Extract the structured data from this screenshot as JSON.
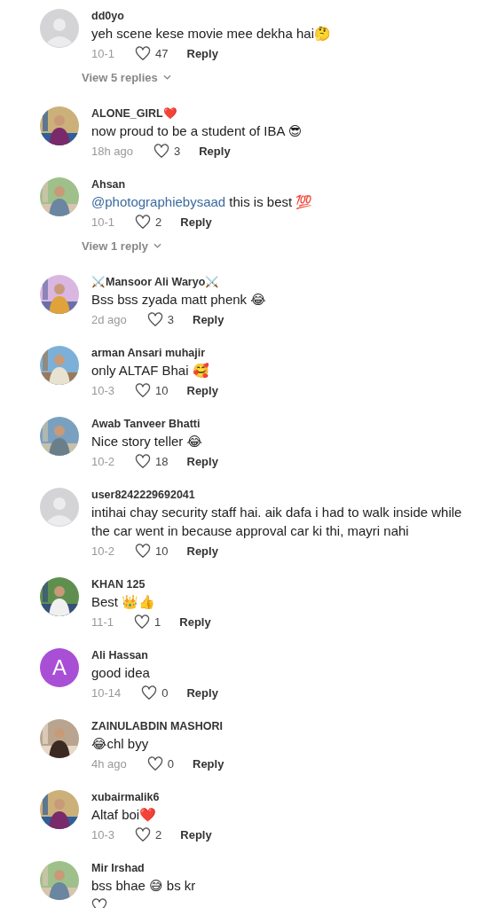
{
  "comments": [
    {
      "avatar": {
        "kind": "default"
      },
      "name": "dd0yo",
      "text": "yeh scene kese movie mee dekha hai🤔",
      "time": "10-1",
      "likes": "47",
      "reply": "Reply",
      "view_replies": "View 5 replies"
    },
    {
      "name": "ALONE_GIRL❤️",
      "text": "now proud to be a student of IBA 😎",
      "time": "18h ago",
      "likes": "3",
      "reply": "Reply"
    },
    {
      "name": "Ahsan",
      "mention": "@photographiebysaad",
      "text": "this is best 💯",
      "time": "10-1",
      "likes": "2",
      "reply": "Reply",
      "view_replies": "View 1 reply"
    },
    {
      "name": "⚔️Mansoor Ali Waryo⚔️",
      "text": "Bss bss zyada matt phenk 😂",
      "time": "2d ago",
      "likes": "3",
      "reply": "Reply"
    },
    {
      "name": "arman Ansari muhajir",
      "text": "only ALTAF Bhai 🥰",
      "time": "10-3",
      "likes": "10",
      "reply": "Reply"
    },
    {
      "name": "Awab Tanveer Bhatti",
      "text": "Nice story teller 😂",
      "time": "10-2",
      "likes": "18",
      "reply": "Reply"
    },
    {
      "avatar": {
        "kind": "default"
      },
      "name": "user8242229692041",
      "text": "intihai chay security staff hai. aik dafa i had to walk inside while the car went in because approval car ki thi, mayri nahi",
      "time": "10-2",
      "likes": "10",
      "reply": "Reply"
    },
    {
      "name": "KHAN 125",
      "text": "Best 👑👍",
      "time": "11-1",
      "likes": "1",
      "reply": "Reply"
    },
    {
      "avatar": {
        "kind": "letter",
        "letter": "A",
        "color": "#a94fd6"
      },
      "name": "Ali Hassan",
      "text": "good idea",
      "time": "10-14",
      "likes": "0",
      "reply": "Reply"
    },
    {
      "name": "ZAINULABDIN MASHORI",
      "text": "😂chl byy",
      "time": "4h ago",
      "likes": "0",
      "reply": "Reply"
    },
    {
      "name": "xubairmalik6",
      "text": "Altaf boi❤️",
      "time": "10-3",
      "likes": "2",
      "reply": "Reply"
    },
    {
      "name": "Mir Irshad",
      "text": "bss bhae 😅 bs kr"
    }
  ]
}
